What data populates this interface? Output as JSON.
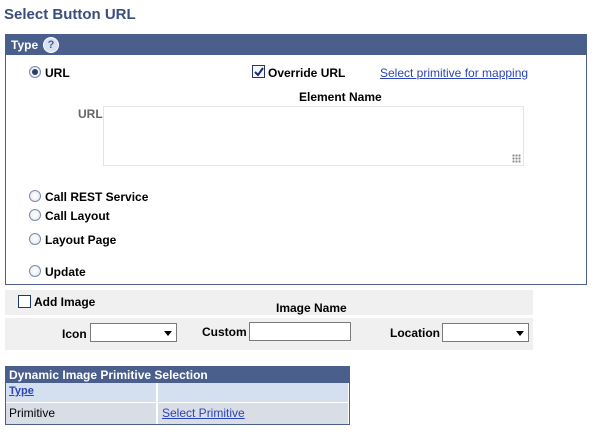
{
  "page_title": "Select Button URL",
  "type_group": {
    "header": "Type",
    "help_glyph": "?",
    "radios": [
      {
        "label": "URL",
        "selected": true
      },
      {
        "label": "Call REST Service",
        "selected": false
      },
      {
        "label": "Call Layout",
        "selected": false
      },
      {
        "label": "Layout Page",
        "selected": false
      },
      {
        "label": "Update",
        "selected": false
      }
    ],
    "override_url": {
      "label": "Override URL",
      "checked": true
    },
    "select_primitive_link": "Select primitive for mapping",
    "element_name_label": "Element Name",
    "url_label": "URL",
    "url_value": ""
  },
  "image_section": {
    "add_image": {
      "label": "Add Image",
      "checked": false
    },
    "image_name_label": "Image Name",
    "icon_label": "Icon",
    "icon_value": "",
    "custom_label": "Custom",
    "custom_value": "",
    "location_label": "Location",
    "location_value": ""
  },
  "grid": {
    "title": "Dynamic Image Primitive Selection",
    "column_header": "Type",
    "row": {
      "type": "Primitive",
      "link": "Select Primitive"
    }
  }
}
